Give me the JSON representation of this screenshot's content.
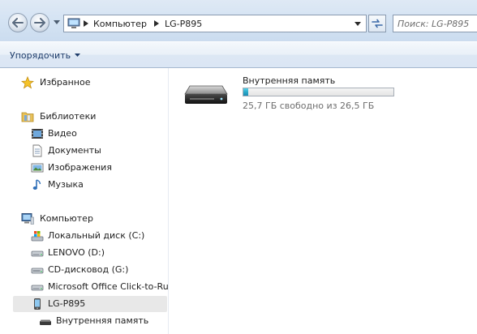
{
  "address_bar": {
    "crumbs": [
      "Компьютер",
      "LG-P895"
    ],
    "search_placeholder": "Поиск: LG-P895"
  },
  "command_bar": {
    "organize_label": "Упорядочить"
  },
  "nav_pane": {
    "favorites": {
      "label": "Избранное",
      "icon": "star-icon"
    },
    "libraries": {
      "label": "Библиотеки",
      "icon": "libraries-folder-icon",
      "items": [
        {
          "label": "Видео",
          "icon": "video-icon"
        },
        {
          "label": "Документы",
          "icon": "documents-icon"
        },
        {
          "label": "Изображения",
          "icon": "pictures-icon"
        },
        {
          "label": "Музыка",
          "icon": "music-icon"
        }
      ]
    },
    "computer": {
      "label": "Компьютер",
      "icon": "computer-icon",
      "items": [
        {
          "label": "Локальный диск (C:)",
          "icon": "windows-drive-icon"
        },
        {
          "label": "LENOVO (D:)",
          "icon": "hard-drive-icon"
        },
        {
          "label": "CD-дисковод (G:)",
          "icon": "cd-drive-icon"
        },
        {
          "label": "Microsoft Office Click-to-Ru",
          "icon": "hard-drive-icon"
        },
        {
          "label": "LG-P895",
          "icon": "phone-icon",
          "selected": true
        },
        {
          "label": "Внутренняя память",
          "icon": "storage-icon"
        }
      ]
    }
  },
  "content": {
    "drive": {
      "name": "Внутренняя память",
      "free_text": "25,7 ГБ свободно из 26,5 ГБ",
      "used_fraction": 0.03,
      "fill_color": "#26a7c9"
    }
  }
}
